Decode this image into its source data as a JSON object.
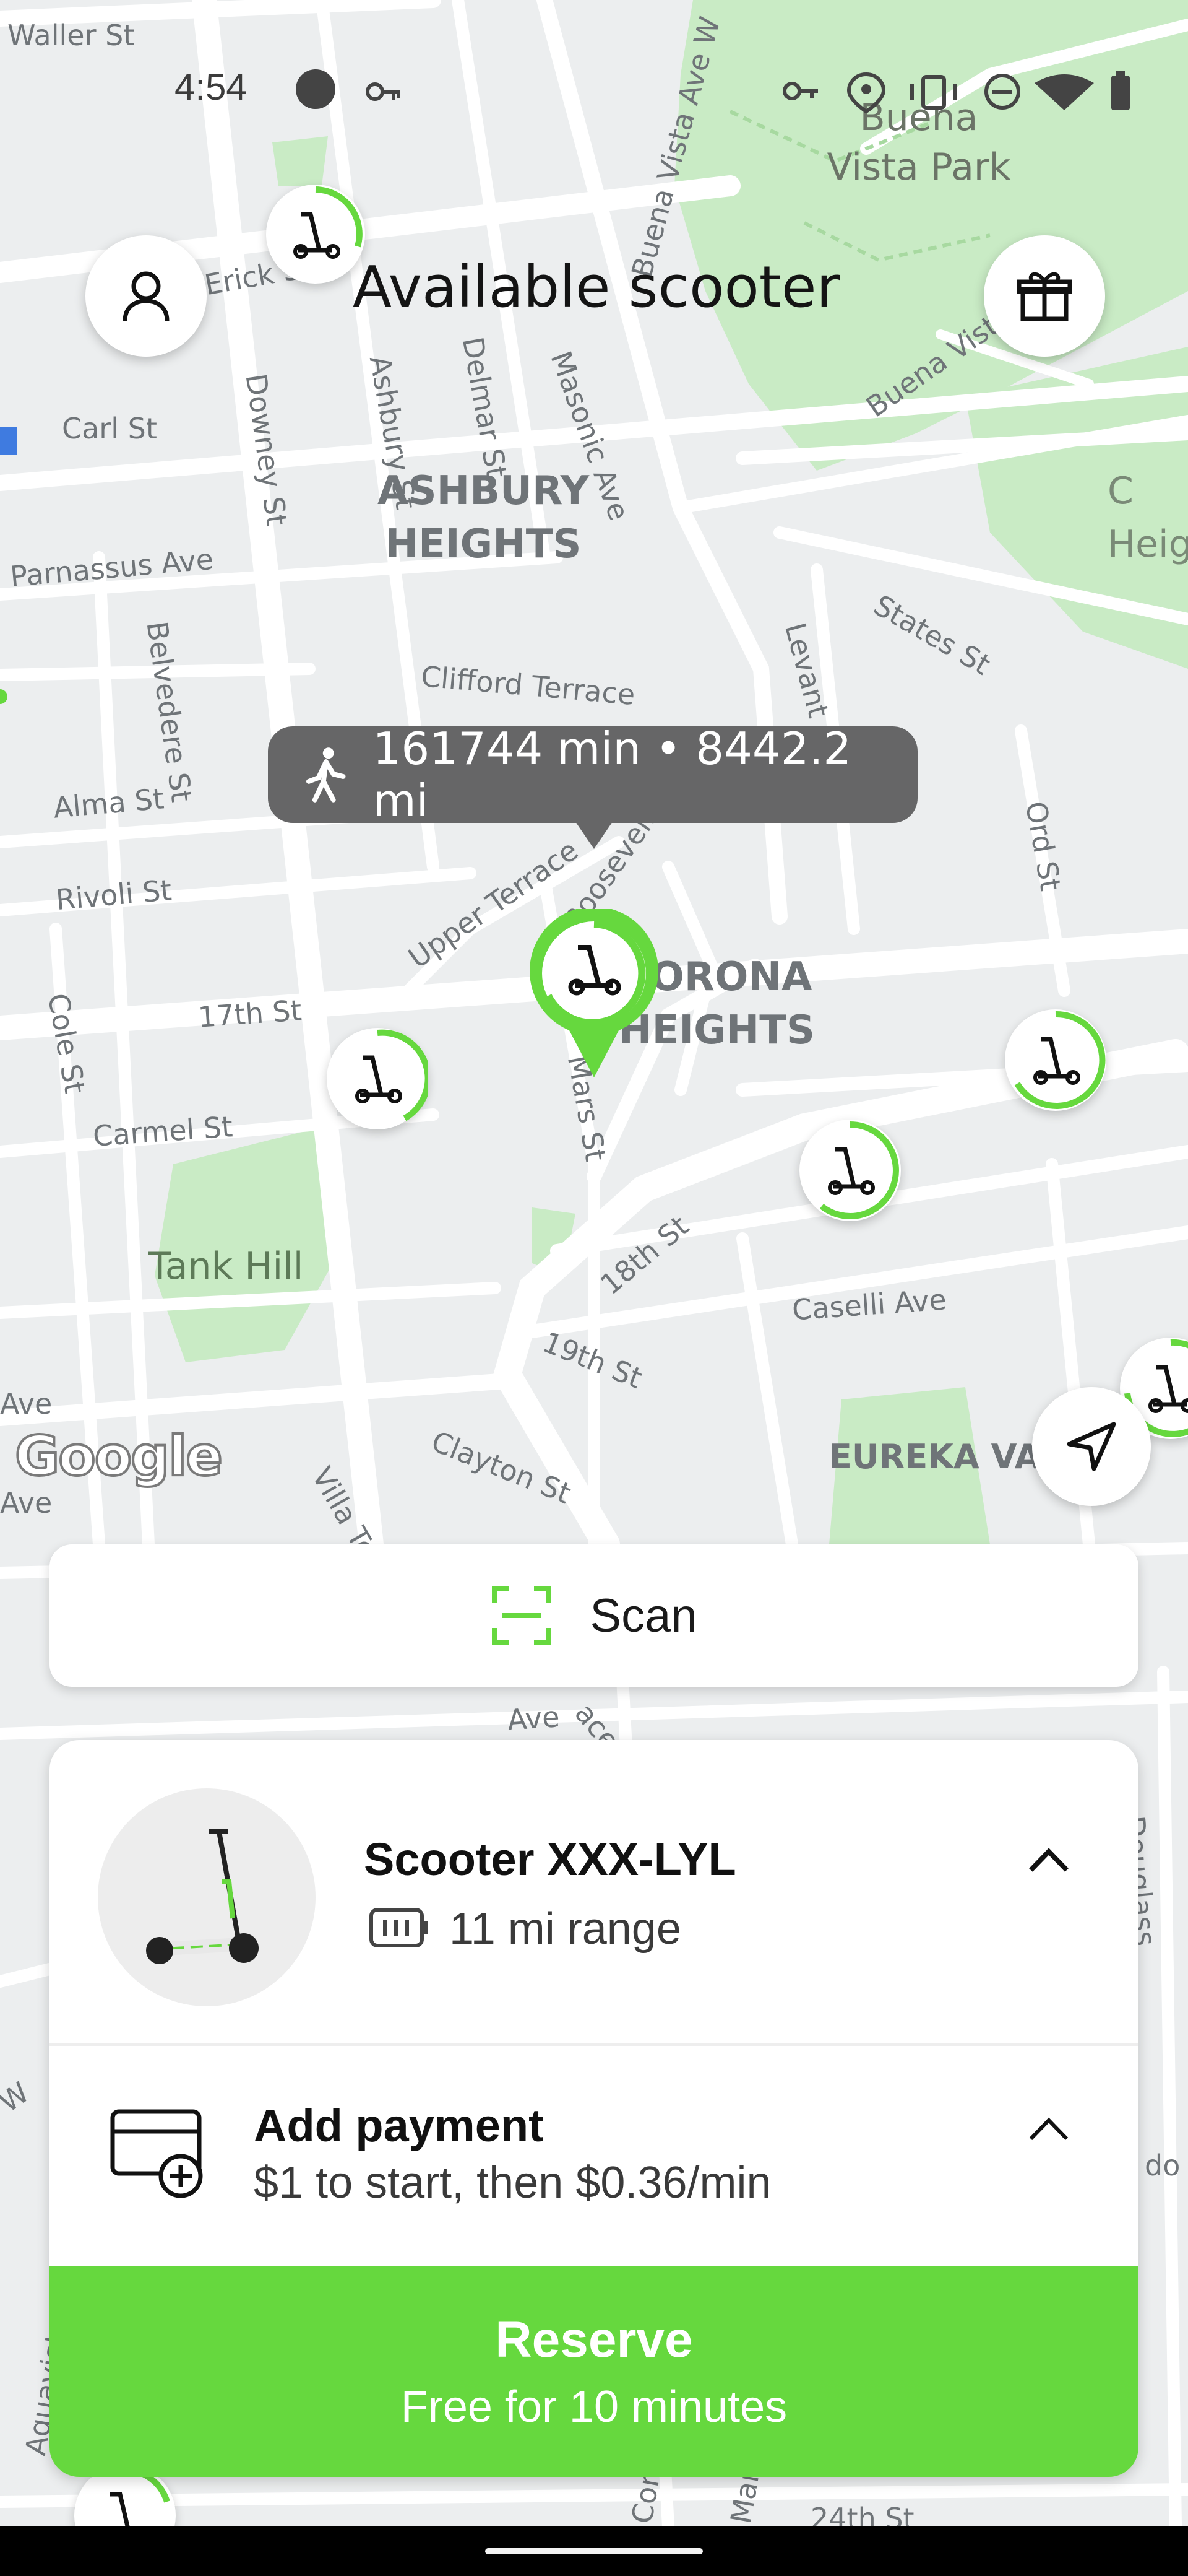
{
  "status_bar": {
    "time": "4:54"
  },
  "header": {
    "title": "Available scooter"
  },
  "map": {
    "attribution": "Google",
    "streets": [
      "Waller St",
      "Carl St",
      "Parnassus Ave",
      "Downey St",
      "Ashbury St",
      "Delmar St",
      "Masonic Ave",
      "Buena Vista Ave W",
      "Buena Vista",
      "Belvedere St",
      "Clifford Terrace",
      "Levant",
      "States St",
      "Alma St",
      "Rivoli St",
      "Upper Terrace",
      "Roosevelt",
      "Ord St",
      "Cole St",
      "17th St",
      "Carmel St",
      "Mars St",
      "18th St",
      "Caselli Ave",
      "19th St",
      "Clayton St",
      "Villa Te",
      "Ave",
      "Ave",
      "Ave",
      "W",
      "ace",
      "do S",
      "Douglass",
      "Aquavista",
      "Corb",
      "Mark",
      "24th St",
      "Erick S"
    ],
    "neighborhoods": [
      {
        "line1": "ASHBURY",
        "line2": "HEIGHTS"
      },
      {
        "line1": "CORONA",
        "line2": "HEIGHTS"
      },
      {
        "line1": "EUREKA VAL",
        "line2": ""
      },
      {
        "line1": "C",
        "line2": "Heig"
      }
    ],
    "parks": [
      "Buena Vista Park",
      "Tank Hill"
    ]
  },
  "walk_tooltip": {
    "icon": "walking-person-icon",
    "text": "161744 min • 8442.2 mi"
  },
  "scan": {
    "label": "Scan",
    "icon": "scan-frame-icon"
  },
  "vehicle": {
    "name": "Scooter XXX-LYL",
    "range": "11 mi range",
    "icon": "battery-icon"
  },
  "payment": {
    "title": "Add payment",
    "price": "$1 to start, then $0.36/min",
    "icon": "card-add-icon"
  },
  "reserve": {
    "label": "Reserve",
    "sub": "Free for 10 minutes"
  },
  "colors": {
    "accent": "#66d83e",
    "tooltip": "#666667",
    "map_bg": "#eceeef",
    "park": "#c9ebc5"
  }
}
